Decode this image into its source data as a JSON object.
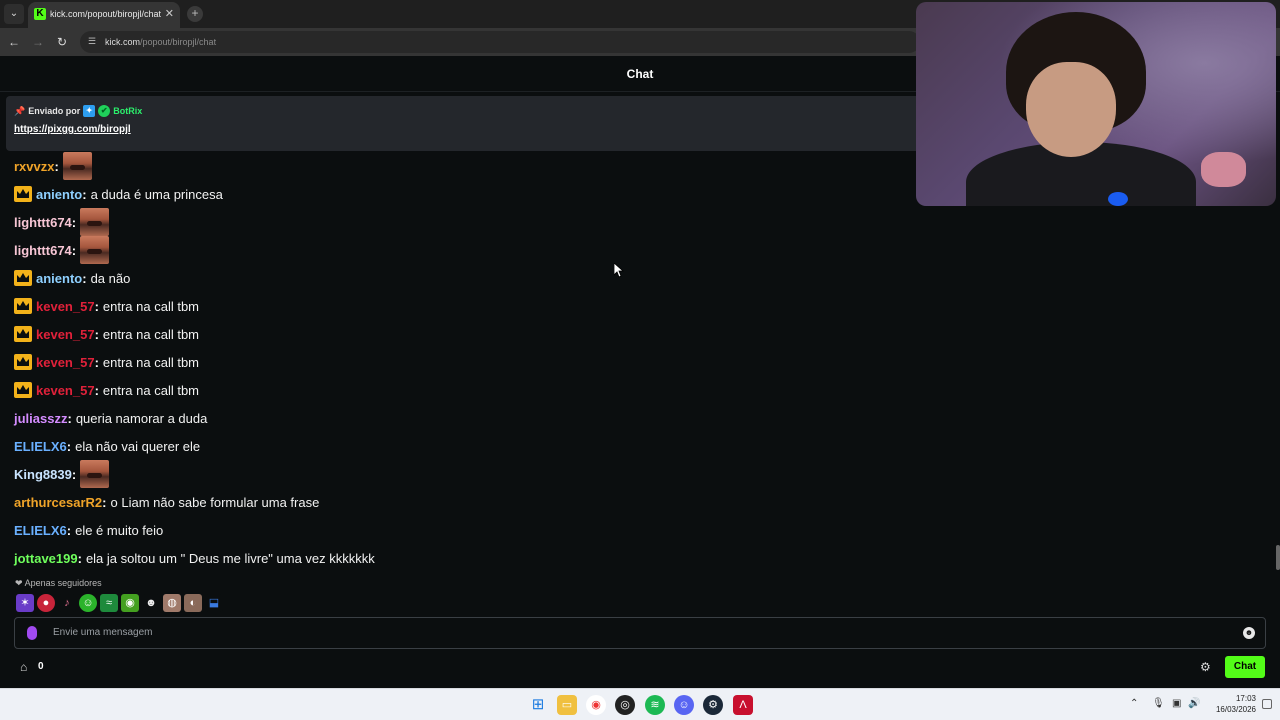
{
  "browser": {
    "tab_title": "kick.com/popout/biropjl/chat",
    "url_domain": "kick.com",
    "url_path": "/popout/biropjl/chat"
  },
  "chat": {
    "header_title": "Chat",
    "pinned": {
      "sent_by_label": "Enviado por",
      "bot_name": "BotRix",
      "link": "https://pixgg.com/biropjl"
    },
    "messages": [
      {
        "user": "rxvvzx",
        "color": "#f0a429",
        "text": "",
        "emote": true,
        "crown": false
      },
      {
        "user": "aniento",
        "color": "#8ed0ff",
        "text": "a duda é uma princesa",
        "emote": false,
        "crown": true
      },
      {
        "user": "lighttt674",
        "color": "#f7c6d5",
        "text": "",
        "emote": true,
        "crown": false
      },
      {
        "user": "lighttt674",
        "color": "#f7c6d5",
        "text": "",
        "emote": true,
        "crown": false
      },
      {
        "user": "aniento",
        "color": "#8ed0ff",
        "text": "da não",
        "emote": false,
        "crown": true
      },
      {
        "user": "keven_57",
        "color": "#e0213a",
        "text": "entra na call tbm",
        "emote": false,
        "crown": true
      },
      {
        "user": "keven_57",
        "color": "#e0213a",
        "text": "entra na call tbm",
        "emote": false,
        "crown": true
      },
      {
        "user": "keven_57",
        "color": "#e0213a",
        "text": "entra na call tbm",
        "emote": false,
        "crown": true
      },
      {
        "user": "keven_57",
        "color": "#e0213a",
        "text": "entra na call tbm",
        "emote": false,
        "crown": true
      },
      {
        "user": "juliasszz",
        "color": "#d48cff",
        "text": "queria namorar a duda",
        "emote": false,
        "crown": false
      },
      {
        "user": "ELIELX6",
        "color": "#6ab0ff",
        "text": "ela não vai querer ele",
        "emote": false,
        "crown": false
      },
      {
        "user": "King8839",
        "color": "#c9e4ff",
        "text": "",
        "emote": true,
        "crown": false
      },
      {
        "user": "arthurcesarR2",
        "color": "#f0a429",
        "text": "o Liam não sabe formular uma frase",
        "emote": false,
        "crown": false
      },
      {
        "user": "ELIELX6",
        "color": "#6ab0ff",
        "text": "ele é muito feio",
        "emote": false,
        "crown": false
      },
      {
        "user": "jottave199",
        "color": "#6fff5c",
        "text": "ela ja soltou um \" Deus me livre\" uma vez kkkkkkk",
        "emote": false,
        "crown": false
      }
    ],
    "followers_only": "Apenas seguidores",
    "input_placeholder": "Envie uma mensagem",
    "points": "0",
    "chat_button": "Chat"
  },
  "taskbar": {
    "time": "17:03",
    "date": "16/03/2026"
  },
  "colors": {
    "kick_green": "#53fc18",
    "background": "#0b0e0f"
  }
}
